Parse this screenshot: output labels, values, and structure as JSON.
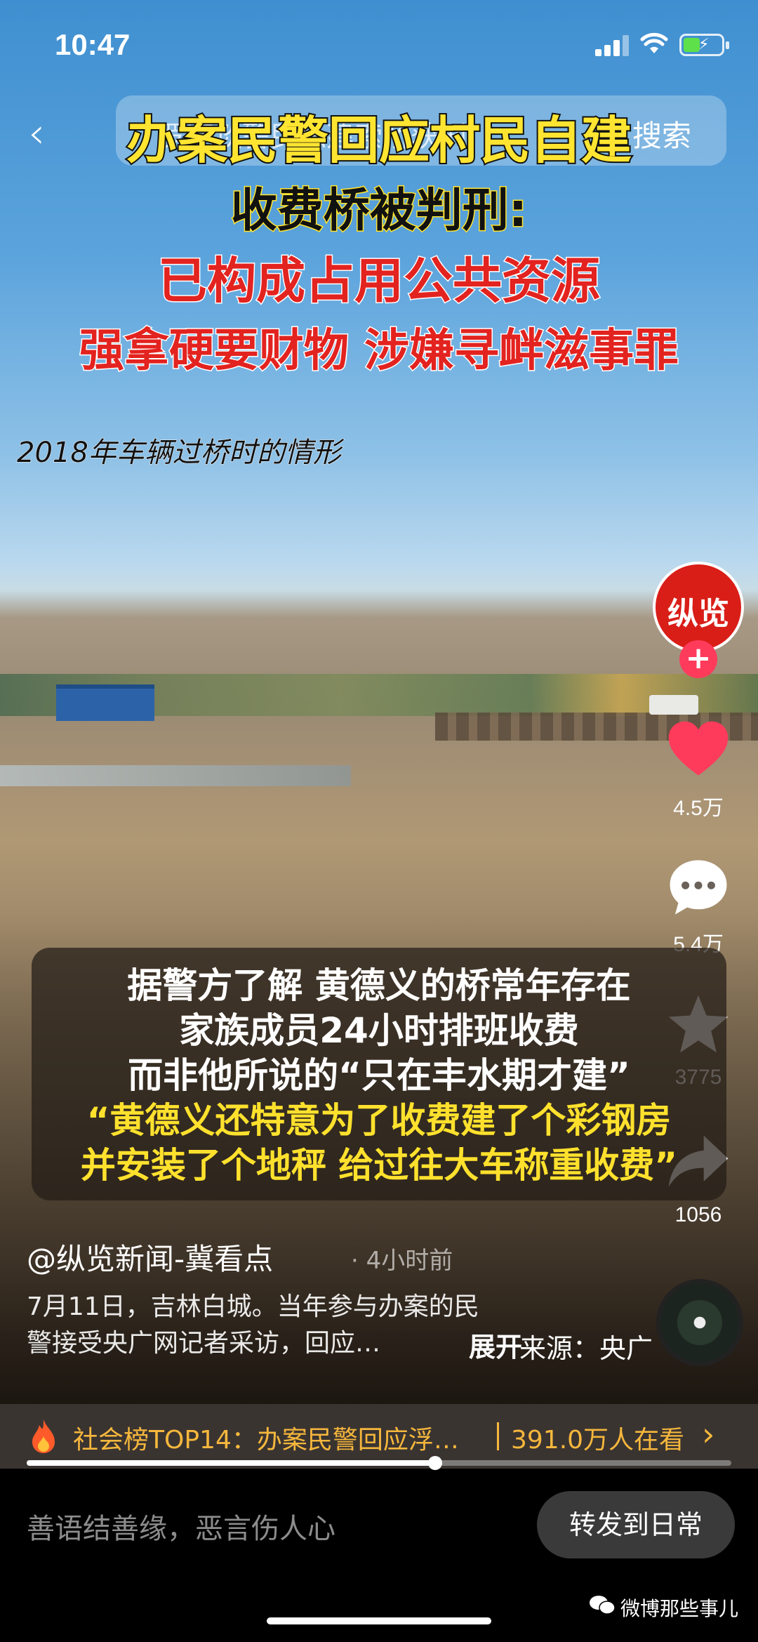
{
  "status_bar": {
    "time": "10:47"
  },
  "nav": {
    "search_placeholder": "罗翔谈警民私建索桥获刑",
    "search_label": "搜索"
  },
  "headline": {
    "line1": "办案民警回应村民自建",
    "line2": "收费桥被判刑:",
    "line3": "已构成占用公共资源",
    "line4": "强拿硬要财物 涉嫌寻衅滋事罪"
  },
  "scene_caption": "2018年车辆过桥时的情形",
  "rail": {
    "avatar_text": "纵览",
    "likes": "4.5万",
    "comments": "5.4万",
    "favorites": "3775",
    "shares": "1056"
  },
  "subtitle": {
    "line1": "据警方了解 黄德义的桥常年存在",
    "line2": "家族成员24小时排班收费",
    "line3": "而非他所说的“只在丰水期才建”",
    "line4": "“黄德义还特意为了收费建了个彩钢房",
    "line5": "并安装了个地秤 给过往大车称重收费”"
  },
  "post": {
    "author": "@纵览新闻-冀看点",
    "age": "· 4小时前",
    "desc_line1": "7月11日，吉林白城。当年参与办案的民",
    "desc_line2": "警接受央广网记者采访，回应…",
    "expand": "展开",
    "source": "来源：央广"
  },
  "hot": {
    "text": "社会榜TOP14：办案民警回应浮…",
    "count": "391.0万人在看",
    "progress": 0.58
  },
  "bottom": {
    "comment_placeholder": "善语结善缘，恶言伤人心",
    "repost": "转发到日常"
  },
  "watermark": "微博那些事儿",
  "colors": {
    "accent_yellow": "#ffe531",
    "accent_red": "#e3231f",
    "hot_orange": "#f6b73c",
    "like_pink": "#ff3b5c"
  },
  "icons": [
    "back-icon",
    "signal-icon",
    "wifi-icon",
    "battery-icon",
    "heart-icon",
    "comment-icon",
    "star-icon",
    "share-icon",
    "fire-icon",
    "chevron-right-icon",
    "wechat-icon"
  ]
}
